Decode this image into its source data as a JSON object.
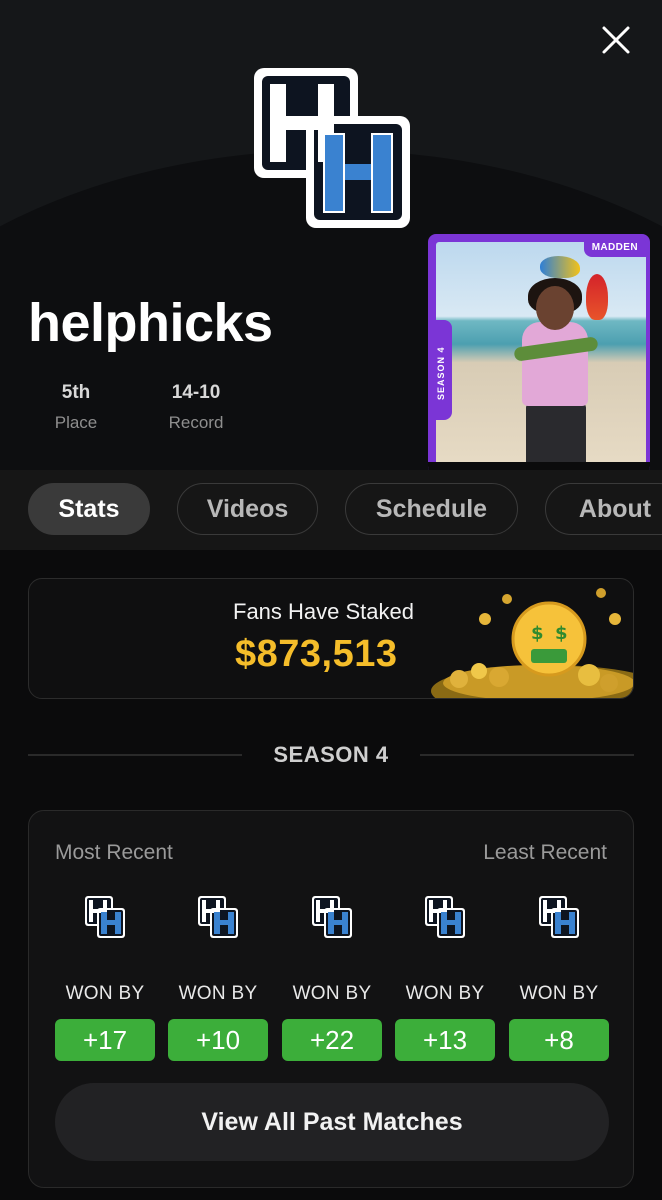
{
  "header": {
    "close_icon": "close-icon",
    "logo_icon": "hh-logo-icon"
  },
  "player": {
    "name": "helphicks",
    "stats": [
      {
        "value": "5th",
        "label": "Place"
      },
      {
        "value": "14-10",
        "label": "Record"
      }
    ]
  },
  "card": {
    "badge": "MADDEN",
    "season": "SEASON 4",
    "accent": "#7b35d6"
  },
  "tabs": [
    {
      "label": "Stats",
      "active": true
    },
    {
      "label": "Videos",
      "active": false
    },
    {
      "label": "Schedule",
      "active": false
    },
    {
      "label": "About",
      "active": false
    }
  ],
  "stake": {
    "label": "Fans Have Staked",
    "amount": "$873,513",
    "amount_color": "#f5bd2a",
    "icon": "money-face-coins-icon"
  },
  "season": {
    "title": "SEASON 4"
  },
  "matches": {
    "left_label": "Most Recent",
    "right_label": "Least Recent",
    "result_color": "#3cae3a",
    "items": [
      {
        "result": "WON BY",
        "margin": "+17"
      },
      {
        "result": "WON BY",
        "margin": "+10"
      },
      {
        "result": "WON BY",
        "margin": "+22"
      },
      {
        "result": "WON BY",
        "margin": "+13"
      },
      {
        "result": "WON BY",
        "margin": "+8"
      }
    ],
    "view_all": "View All Past Matches"
  }
}
